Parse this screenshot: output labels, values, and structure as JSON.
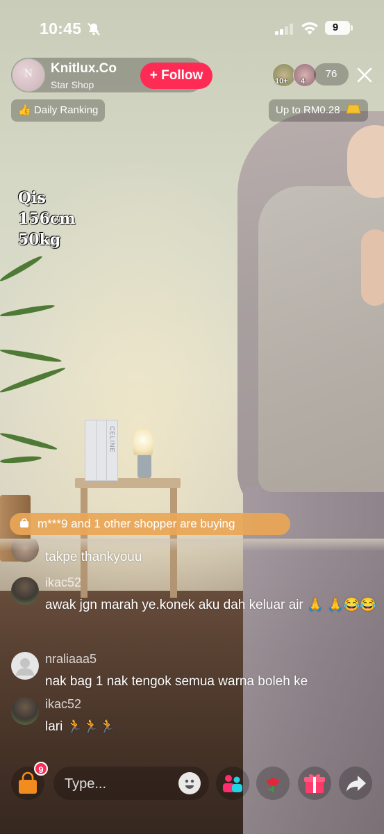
{
  "status_bar": {
    "time": "10:45",
    "battery": "9"
  },
  "host": {
    "name": "Knitlux.Co",
    "subtitle": "Star Shop",
    "avatar_text": "N",
    "follow_label": "+ Follow"
  },
  "viewers": {
    "badge_1": "10+",
    "badge_2": "4",
    "count": "76"
  },
  "pills": {
    "ranking": "Daily Ranking",
    "reward": "Up to RM0.28"
  },
  "overlay_text": {
    "line1": "Qis",
    "line2": "156cm",
    "line3": "50kg"
  },
  "scene_text": {
    "book_label": "CELINE"
  },
  "shopper_banner": "m***9 and 1 other shopper are buying",
  "comments": [
    {
      "user": "",
      "text": "takpe thankyouu"
    },
    {
      "user": "ikac52",
      "text": "awak jgn marah ye.konek aku dah keluar air 🙏 🙏😂😂"
    },
    {
      "user": "nraliaaa5",
      "text": "nak bag 1 nak tengok semua warna boleh ke"
    },
    {
      "user": "ikac52",
      "text": "lari 🏃🏃🏃"
    }
  ],
  "bottom_bar": {
    "cart_count": "9",
    "input_placeholder": "Type..."
  },
  "colors": {
    "follow": "#fe2c55",
    "shopper_banner": "#e9a656"
  }
}
